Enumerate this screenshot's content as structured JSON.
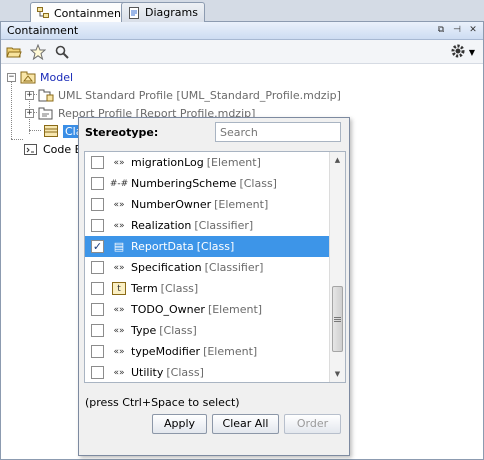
{
  "tabs": [
    {
      "label": "Containment",
      "active": true
    },
    {
      "label": "Diagrams",
      "active": false
    }
  ],
  "panel": {
    "title": "Containment"
  },
  "tree": {
    "root_label": "Model",
    "children": [
      {
        "label": "UML Standard Profile [UML_Standard_Profile.mdzip]"
      },
      {
        "label": "Report Profile [Report Profile.mdzip]"
      },
      {
        "label": "Cla"
      },
      {
        "label": "Code E"
      }
    ]
  },
  "popup": {
    "title": "Stereotype:",
    "search_placeholder": "Search",
    "items": [
      {
        "icon": "«»",
        "name": "migrationLog",
        "meta": "[Element]",
        "checked": false,
        "selected": false
      },
      {
        "icon": "#-#",
        "name": "NumberingScheme",
        "meta": "[Class]",
        "checked": false,
        "selected": false
      },
      {
        "icon": "«»",
        "name": "NumberOwner",
        "meta": "[Element]",
        "checked": false,
        "selected": false
      },
      {
        "icon": "«»",
        "name": "Realization",
        "meta": "[Classifier]",
        "checked": false,
        "selected": false
      },
      {
        "icon": "▤",
        "name": "ReportData",
        "meta": "[Class]",
        "checked": true,
        "selected": true
      },
      {
        "icon": "«»",
        "name": "Specification",
        "meta": "[Classifier]",
        "checked": false,
        "selected": false
      },
      {
        "icon": "t",
        "name": "Term",
        "meta": "[Class]",
        "checked": false,
        "selected": false
      },
      {
        "icon": "«»",
        "name": "TODO_Owner",
        "meta": "[Element]",
        "checked": false,
        "selected": false
      },
      {
        "icon": "«»",
        "name": "Type",
        "meta": "[Class]",
        "checked": false,
        "selected": false
      },
      {
        "icon": "«»",
        "name": "typeModifier",
        "meta": "[Element]",
        "checked": false,
        "selected": false
      },
      {
        "icon": "«»",
        "name": "Utility",
        "meta": "[Class]",
        "checked": false,
        "selected": false
      }
    ],
    "hint": "(press Ctrl+Space to select)",
    "buttons": {
      "apply": "Apply",
      "clear_all": "Clear All",
      "order": "Order"
    }
  },
  "colors": {
    "selection": "#3d95e8",
    "model_text": "#1a2bb8"
  }
}
